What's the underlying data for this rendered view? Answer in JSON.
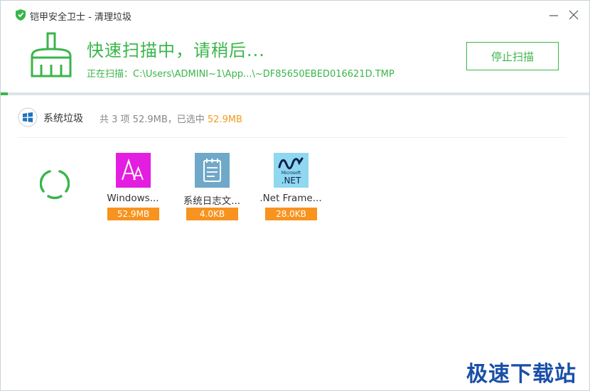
{
  "window": {
    "title": "铠甲安全卫士 - 清理垃圾"
  },
  "header": {
    "scan_title": "快速扫描中，请稍后...",
    "scan_path": "正在扫描：C:\\Users\\ADMINI~1\\App...\\~DF85650EBED016621D.TMP",
    "stop_label": "停止扫描",
    "progress_fraction": 0.012
  },
  "category": {
    "name": "系统垃圾",
    "summary_prefix": "共 3 项 52.9MB，已选中",
    "selected_size": "52.9MB"
  },
  "items": [
    {
      "label": "Windows...",
      "size": "52.9MB",
      "icon": "font-icon"
    },
    {
      "label": "系统日志文...",
      "size": "4.0KB",
      "icon": "notepad-icon"
    },
    {
      "label": ".Net Frame...",
      "size": "28.0KB",
      "icon": "dotnet-icon",
      "icon_text": ".NET",
      "icon_subtext": "Microsoft"
    }
  ],
  "watermark": "极速下载站",
  "colors": {
    "accent": "#3ab54a",
    "size_badge": "#f7931e",
    "watermark": "#1a4fa8"
  }
}
